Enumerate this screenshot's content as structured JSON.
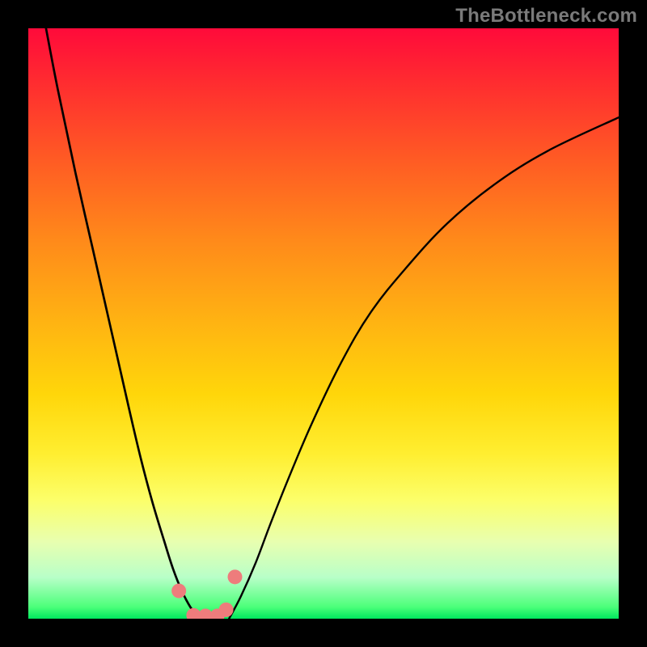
{
  "watermark": {
    "text": "TheBottleneck.com"
  },
  "colors": {
    "page_background": "#000000",
    "curve": "#000000",
    "marker_fill": "#ee7c7c",
    "marker_stroke": "#e06666",
    "gradient_stops": [
      "#ff0a3a",
      "#ff2f2f",
      "#ff5a24",
      "#ff8a1a",
      "#ffb412",
      "#ffd60a",
      "#ffee30",
      "#fcff6a",
      "#e8ffb0",
      "#b8ffc8",
      "#4cff7a",
      "#00e85e"
    ]
  },
  "chart_data": {
    "type": "line",
    "title": "",
    "xlabel": "",
    "ylabel": "",
    "xlim": [
      0,
      100
    ],
    "ylim": [
      0,
      106
    ],
    "grid": false,
    "legend": false,
    "annotations": [],
    "left_curve": {
      "name": "left-branch",
      "x": [
        3,
        5,
        8,
        11,
        14,
        17,
        19,
        21,
        23,
        24.5,
        26,
        27.5,
        29
      ],
      "y": [
        106,
        95,
        80,
        66,
        52,
        38,
        29,
        21,
        14,
        9,
        5,
        2,
        0
      ]
    },
    "right_curve": {
      "name": "right-branch",
      "x": [
        34,
        36,
        38.5,
        41,
        44,
        48,
        53,
        58,
        64,
        71,
        79,
        88,
        100
      ],
      "y": [
        0,
        4,
        10,
        17,
        25,
        35,
        46,
        55,
        63,
        71,
        78,
        84,
        90
      ]
    },
    "markers": {
      "name": "bottom-markers",
      "x": [
        25.5,
        28.0,
        30.0,
        32.0,
        33.5,
        35.0
      ],
      "y": [
        5.0,
        0.6,
        0.5,
        0.5,
        1.6,
        7.5
      ]
    }
  }
}
